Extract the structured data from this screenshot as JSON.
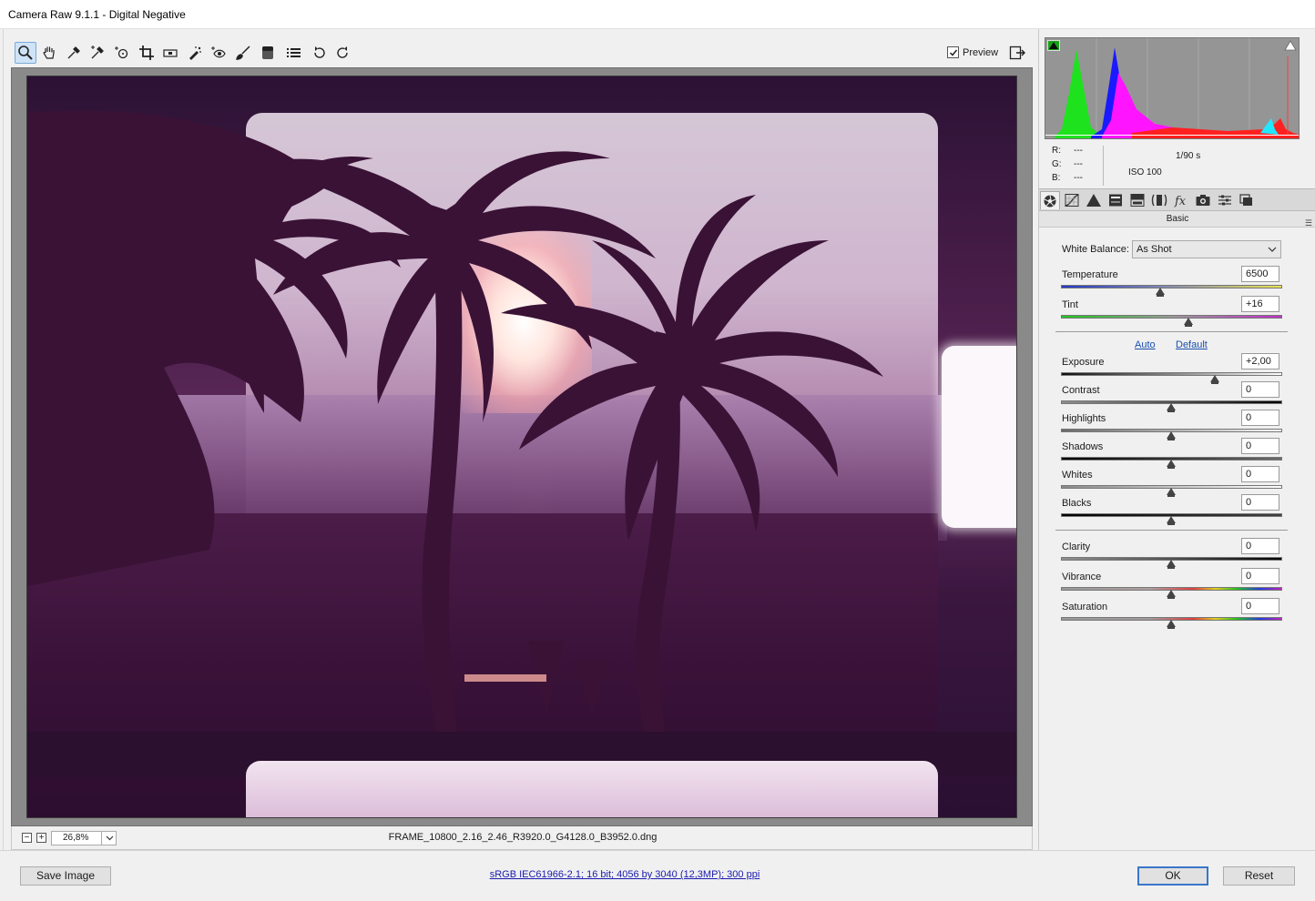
{
  "window": {
    "title": "Camera Raw 9.1.1  -  Digital Negative"
  },
  "toolbar": {
    "tools": [
      {
        "name": "zoom-tool",
        "icon": "magnifier-icon"
      },
      {
        "name": "hand-tool",
        "icon": "hand-icon"
      },
      {
        "name": "white-balance-tool",
        "icon": "eyedropper-icon"
      },
      {
        "name": "color-sampler-tool",
        "icon": "color-sampler-icon"
      },
      {
        "name": "targeted-adjustment-tool",
        "icon": "target-icon"
      },
      {
        "name": "crop-tool",
        "icon": "crop-icon"
      },
      {
        "name": "straighten-tool",
        "icon": "level-icon"
      },
      {
        "name": "spot-removal-tool",
        "icon": "spot-removal-icon"
      },
      {
        "name": "red-eye-tool",
        "icon": "eye-icon"
      },
      {
        "name": "adjustment-brush-tool",
        "icon": "brush-icon"
      },
      {
        "name": "graduated-filter-tool",
        "icon": "gradient-icon"
      },
      {
        "name": "preferences-tool",
        "icon": "list-icon"
      },
      {
        "name": "rotate-ccw-tool",
        "icon": "rotate-ccw-icon"
      },
      {
        "name": "rotate-cw-tool",
        "icon": "rotate-cw-icon"
      }
    ],
    "preview_label": "Preview",
    "preview_checked": true
  },
  "status": {
    "zoom_value": "26,8%",
    "filename": "FRAME_10800_2.16_2.46_R3920.0_G4128.0_B3952.0.dng"
  },
  "info": {
    "r_label": "R:",
    "r_value": "---",
    "g_label": "G:",
    "g_value": "---",
    "b_label": "B:",
    "b_value": "---",
    "shutter": "1/90 s",
    "iso": "ISO 100"
  },
  "panel": {
    "section_title": "Basic",
    "white_balance_label": "White Balance:",
    "white_balance_value": "As Shot",
    "temperature_label": "Temperature",
    "temperature_value": "6500",
    "tint_label": "Tint",
    "tint_value": "+16",
    "auto_label": "Auto",
    "default_label": "Default",
    "exposure_label": "Exposure",
    "exposure_value": "+2,00",
    "contrast_label": "Contrast",
    "contrast_value": "0",
    "highlights_label": "Highlights",
    "highlights_value": "0",
    "shadows_label": "Shadows",
    "shadows_value": "0",
    "whites_label": "Whites",
    "whites_value": "0",
    "blacks_label": "Blacks",
    "blacks_value": "0",
    "clarity_label": "Clarity",
    "clarity_value": "0",
    "vibrance_label": "Vibrance",
    "vibrance_value": "0",
    "saturation_label": "Saturation",
    "saturation_value": "0"
  },
  "footer": {
    "save_label": "Save Image",
    "workflow_label": "sRGB IEC61966-2.1; 16 bit; 4056 by 3040 (12,3MP); 300 ppi",
    "ok_label": "OK",
    "reset_label": "Reset"
  },
  "colors": {
    "accent": "#3a76c9",
    "link": "#1a1ab0",
    "histogram_bg": "#959595"
  }
}
